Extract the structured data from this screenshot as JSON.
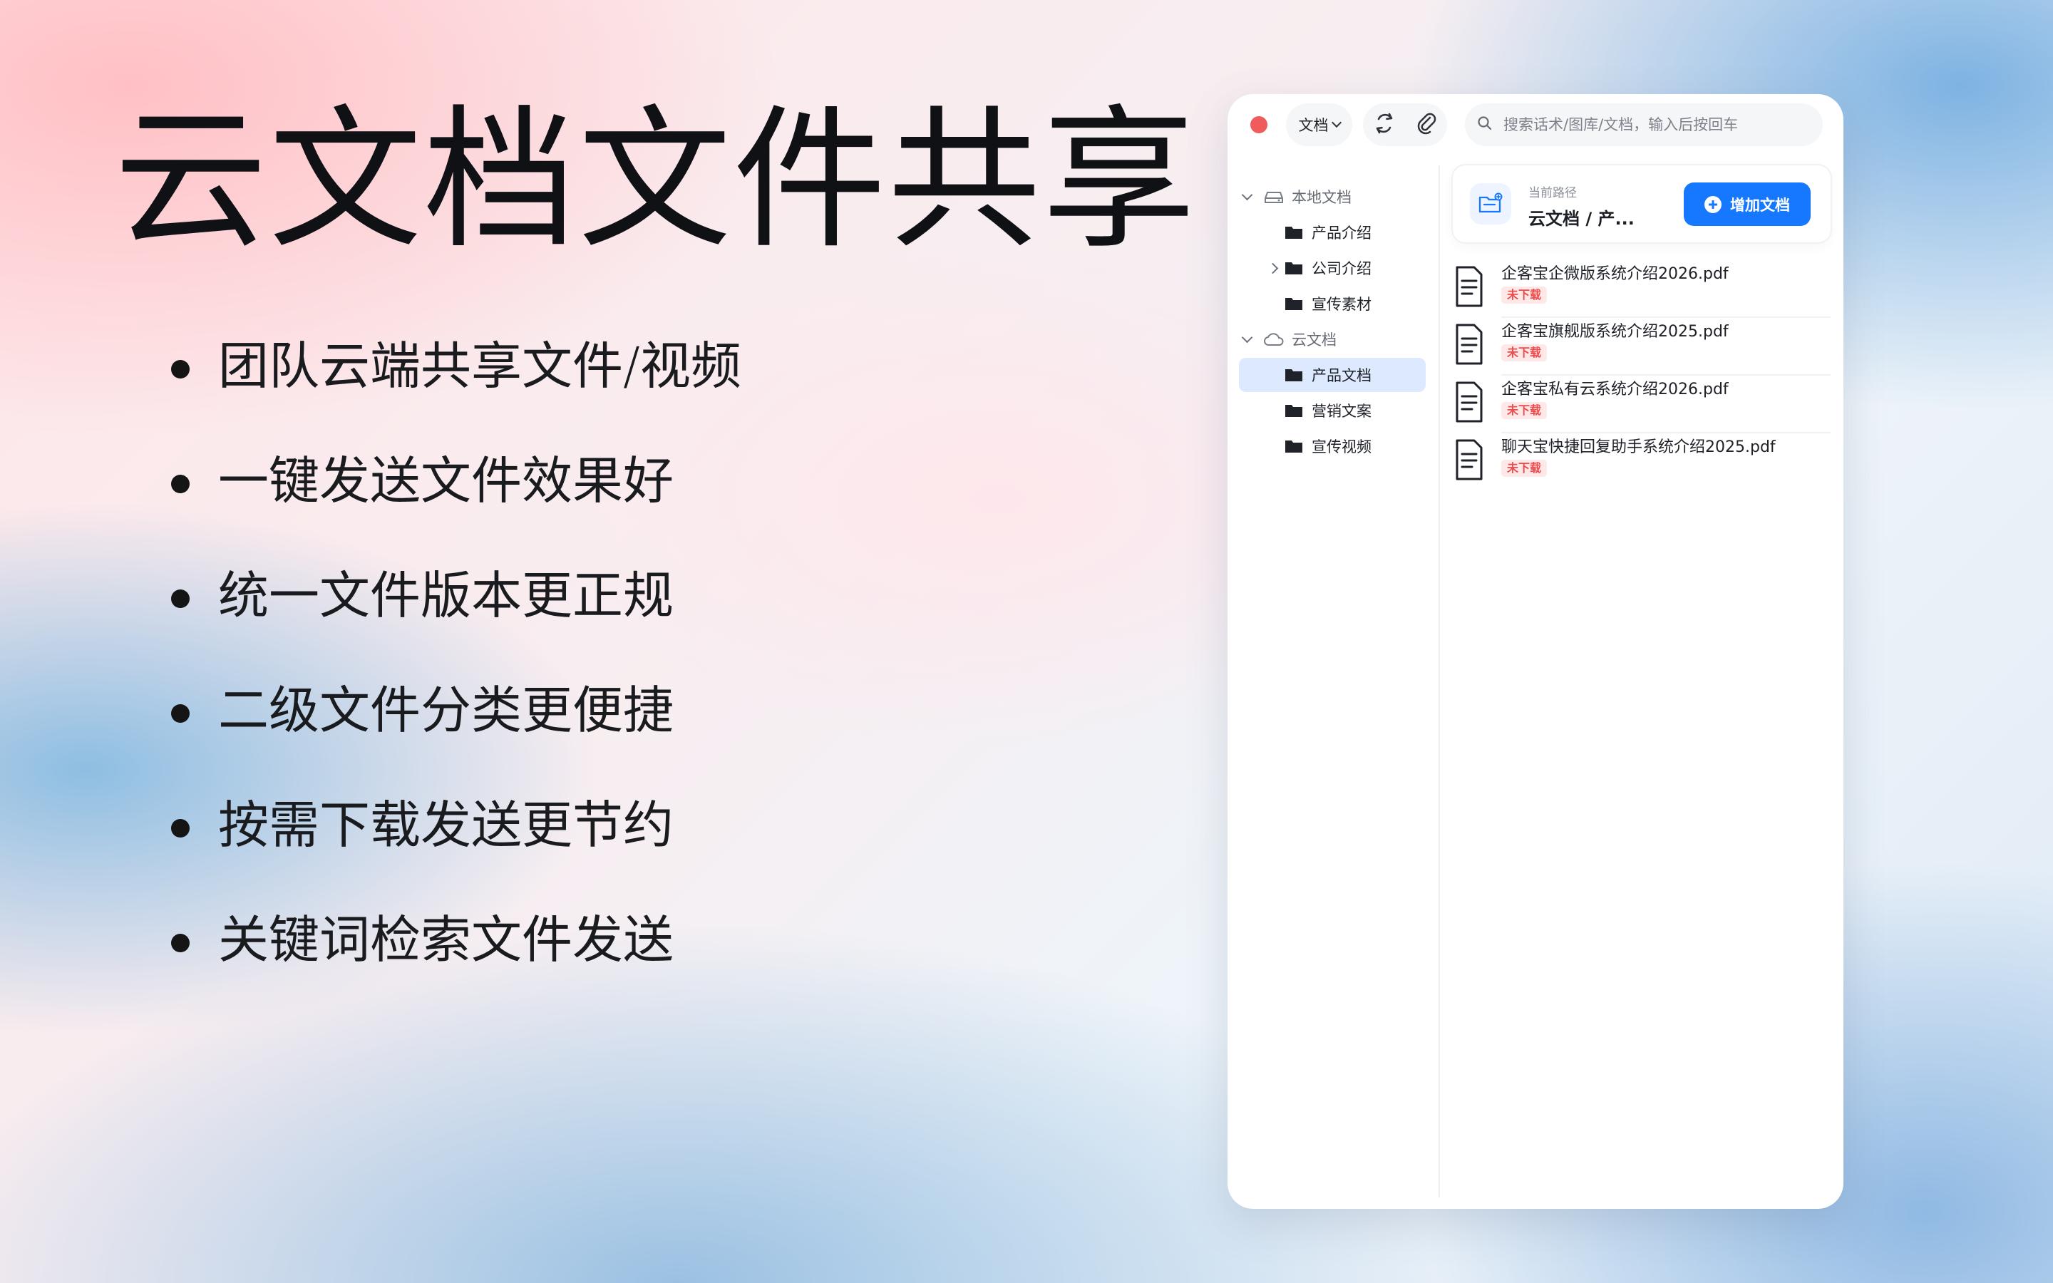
{
  "hero": {
    "title": "云文档文件共享"
  },
  "features": [
    "团队云端共享文件/视频",
    "一键发送文件效果好",
    "统一文件版本更正规",
    "二级文件分类更便捷",
    "按需下载发送更节约",
    "关键词检索文件发送"
  ],
  "app": {
    "toolbar": {
      "dropdown_label": "文档",
      "search_placeholder": "搜索话术/图库/文档，输入后按回车"
    },
    "sidebar": {
      "local_docs_label": "本地文档",
      "local_docs_items": [
        "产品介绍",
        "公司介绍",
        "宣传素材"
      ],
      "cloud_docs_label": "云文档",
      "cloud_docs_items": [
        "产品文档",
        "营销文案",
        "宣传视频"
      ],
      "active_item": "产品文档"
    },
    "main": {
      "path_caption": "当前路径",
      "path_value": "云文档 / 产...",
      "add_button_label": "增加文档",
      "documents": [
        {
          "name": "企客宝企微版系统介绍2026.pdf",
          "status": "未下载"
        },
        {
          "name": "企客宝旗舰版系统介绍2025.pdf",
          "status": "未下载"
        },
        {
          "name": "企客宝私有云系统介绍2026.pdf",
          "status": "未下载"
        },
        {
          "name": "聊天宝快捷回复助手系统介绍2025.pdf",
          "status": "未下载"
        }
      ]
    }
  },
  "colors": {
    "accent": "#1677ff",
    "close_dot": "#f05b5b",
    "selected_bg": "#dce9ff",
    "badge_bg": "#ffe8e8",
    "badge_text": "#f04a4a"
  },
  "icons": {
    "refresh": "refresh-icon",
    "attachment": "paperclip-icon",
    "search": "search-icon",
    "folder": "folder-icon",
    "drive": "drive-icon",
    "cloud": "cloud-icon",
    "document": "document-icon"
  }
}
